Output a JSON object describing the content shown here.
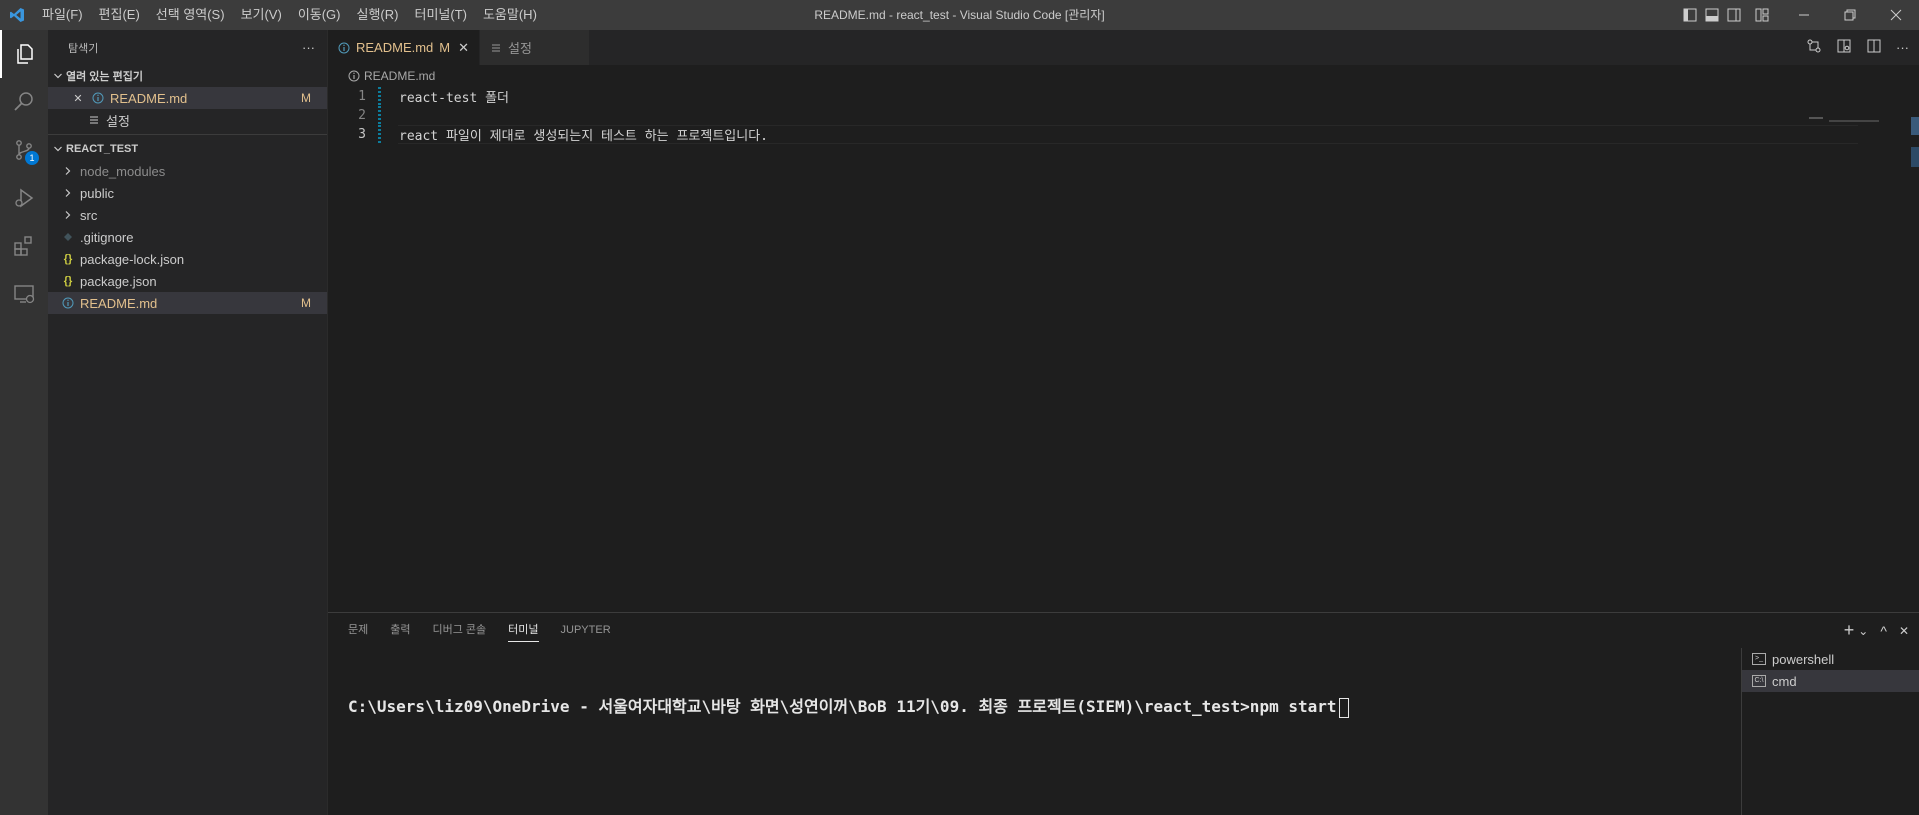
{
  "window": {
    "title": "README.md - react_test - Visual Studio Code [관리자]"
  },
  "menu": [
    "파일(F)",
    "편집(E)",
    "선택 영역(S)",
    "보기(V)",
    "이동(G)",
    "실행(R)",
    "터미널(T)",
    "도움말(H)"
  ],
  "activity": {
    "scm_badge": "1"
  },
  "sidebar": {
    "title": "탐색기",
    "more": "···",
    "open_editors": {
      "heading": "열려 있는 편집기",
      "items": [
        {
          "label": "README.md",
          "mark": "M"
        },
        {
          "label": "설정"
        }
      ]
    },
    "project": {
      "heading": "REACT_TEST",
      "items": [
        {
          "label": "node_modules"
        },
        {
          "label": "public"
        },
        {
          "label": "src"
        },
        {
          "label": ".gitignore"
        },
        {
          "label": "package-lock.json",
          "icon_text": "{}"
        },
        {
          "label": "package.json",
          "icon_text": "{}"
        },
        {
          "label": "README.md",
          "mark": "M"
        }
      ]
    }
  },
  "editor": {
    "tabs": [
      {
        "label": "README.md",
        "mark": "M",
        "close": "✕"
      },
      {
        "label": "설정"
      }
    ],
    "more": "···",
    "breadcrumb": "README.md",
    "lines": [
      {
        "num": "1",
        "text": "react-test 폴더"
      },
      {
        "num": "2",
        "text": ""
      },
      {
        "num": "3",
        "text": "react 파일이 제대로 생성되는지 테스트 하는 프로젝트입니다."
      }
    ]
  },
  "panel": {
    "tabs": [
      "문제",
      "출력",
      "디버그 콘솔",
      "터미널",
      "JUPYTER"
    ],
    "active_tab": "터미널",
    "terminal_line": "C:\\Users\\liz09\\OneDrive - 서울여자대학교\\바탕 화면\\성연이꺼\\BoB 11기\\09. 최종 프로젝트(SIEM)\\react_test>npm start",
    "terminals": [
      {
        "label": "powershell",
        "icon_text": ">_"
      },
      {
        "label": "cmd",
        "icon_text": "C:\\"
      }
    ],
    "actions": {
      "add": "+",
      "dropdown": "⌄",
      "maximize": "^",
      "close": "✕"
    }
  },
  "colors": {
    "accent": "#0078d4",
    "modified": "#e2c08d",
    "activity_bar": "#333333",
    "sidebar": "#252526",
    "editor_bg": "#1e1e1e"
  }
}
